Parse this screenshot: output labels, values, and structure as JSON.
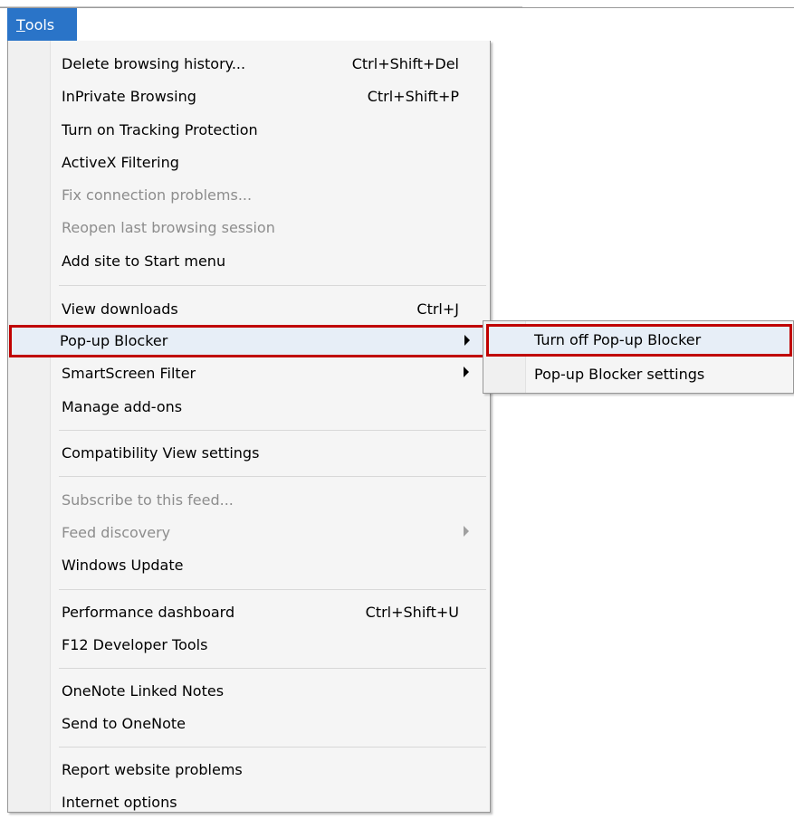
{
  "menubar": {
    "tools_label_underlined": "T",
    "tools_label_rest": "ools"
  },
  "menu": {
    "items": [
      {
        "label": "Delete browsing history...",
        "shortcut": "Ctrl+Shift+Del",
        "disabled": false,
        "submenu": false
      },
      {
        "label": "InPrivate Browsing",
        "shortcut": "Ctrl+Shift+P",
        "disabled": false,
        "submenu": false
      },
      {
        "label": "Turn on Tracking Protection",
        "shortcut": "",
        "disabled": false,
        "submenu": false
      },
      {
        "label": "ActiveX Filtering",
        "shortcut": "",
        "disabled": false,
        "submenu": false
      },
      {
        "label": "Fix connection problems...",
        "shortcut": "",
        "disabled": true,
        "submenu": false
      },
      {
        "label": "Reopen last browsing session",
        "shortcut": "",
        "disabled": true,
        "submenu": false
      },
      {
        "label": "Add site to Start menu",
        "shortcut": "",
        "disabled": false,
        "submenu": false
      },
      {
        "label": "View downloads",
        "shortcut": "Ctrl+J",
        "disabled": false,
        "submenu": false
      },
      {
        "label": "Pop-up Blocker",
        "shortcut": "",
        "disabled": false,
        "submenu": true,
        "highlighted": true
      },
      {
        "label": "SmartScreen Filter",
        "shortcut": "",
        "disabled": false,
        "submenu": true
      },
      {
        "label": "Manage add-ons",
        "shortcut": "",
        "disabled": false,
        "submenu": false
      },
      {
        "label": "Compatibility View settings",
        "shortcut": "",
        "disabled": false,
        "submenu": false
      },
      {
        "label": "Subscribe to this feed...",
        "shortcut": "",
        "disabled": true,
        "submenu": false
      },
      {
        "label": "Feed discovery",
        "shortcut": "",
        "disabled": true,
        "submenu": true
      },
      {
        "label": "Windows Update",
        "shortcut": "",
        "disabled": false,
        "submenu": false
      },
      {
        "label": "Performance dashboard",
        "shortcut": "Ctrl+Shift+U",
        "disabled": false,
        "submenu": false
      },
      {
        "label": "F12 Developer Tools",
        "shortcut": "",
        "disabled": false,
        "submenu": false
      },
      {
        "label": "OneNote Linked Notes",
        "shortcut": "",
        "disabled": false,
        "submenu": false
      },
      {
        "label": "Send to OneNote",
        "shortcut": "",
        "disabled": false,
        "submenu": false
      },
      {
        "label": "Report website problems",
        "shortcut": "",
        "disabled": false,
        "submenu": false
      },
      {
        "label": "Internet options",
        "shortcut": "",
        "disabled": false,
        "submenu": false
      }
    ]
  },
  "submenu": {
    "items": [
      {
        "label": "Turn off Pop-up Blocker",
        "highlighted": true
      },
      {
        "label": "Pop-up Blocker settings"
      }
    ]
  },
  "colors": {
    "menu_title_bg": "#2a74c8",
    "highlight_border": "#c00000",
    "disabled_text": "#8d8d8d"
  }
}
